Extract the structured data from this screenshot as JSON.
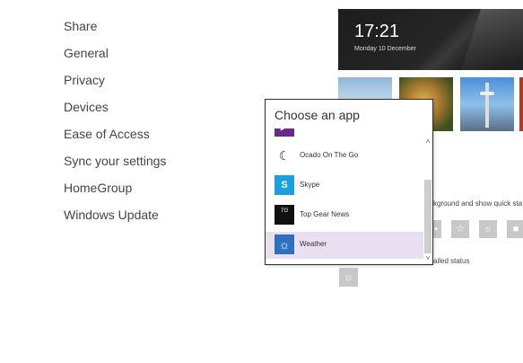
{
  "nav": {
    "items": [
      "Share",
      "General",
      "Privacy",
      "Devices",
      "Ease of Access",
      "Sync your settings",
      "HomeGroup",
      "Windows Update"
    ]
  },
  "lock_screen": {
    "time": "17:21",
    "date": "Monday 10 December"
  },
  "background_text_1": "kground and show quick sta",
  "background_text_2": "ailed status",
  "popup": {
    "title": "Choose an app",
    "apps": [
      {
        "label": "",
        "icon": "partial-app-icon",
        "color": "#6b2a8a"
      },
      {
        "label": "Ocado On The Go",
        "icon": "ocado-moon-icon",
        "color": "#ffffff"
      },
      {
        "label": "Skype",
        "icon": "skype-icon",
        "color": "#1aa0e0"
      },
      {
        "label": "Top Gear News",
        "icon": "top-gear-icon",
        "color": "#111111"
      },
      {
        "label": "Weather",
        "icon": "weather-sun-icon",
        "color": "#2f6fc0"
      }
    ],
    "selected": "Weather"
  },
  "quick_status_icons": [
    "lock-icon",
    "star-icon",
    "sun-icon",
    "message-icon"
  ],
  "detailed_status_icon": "sun-icon"
}
